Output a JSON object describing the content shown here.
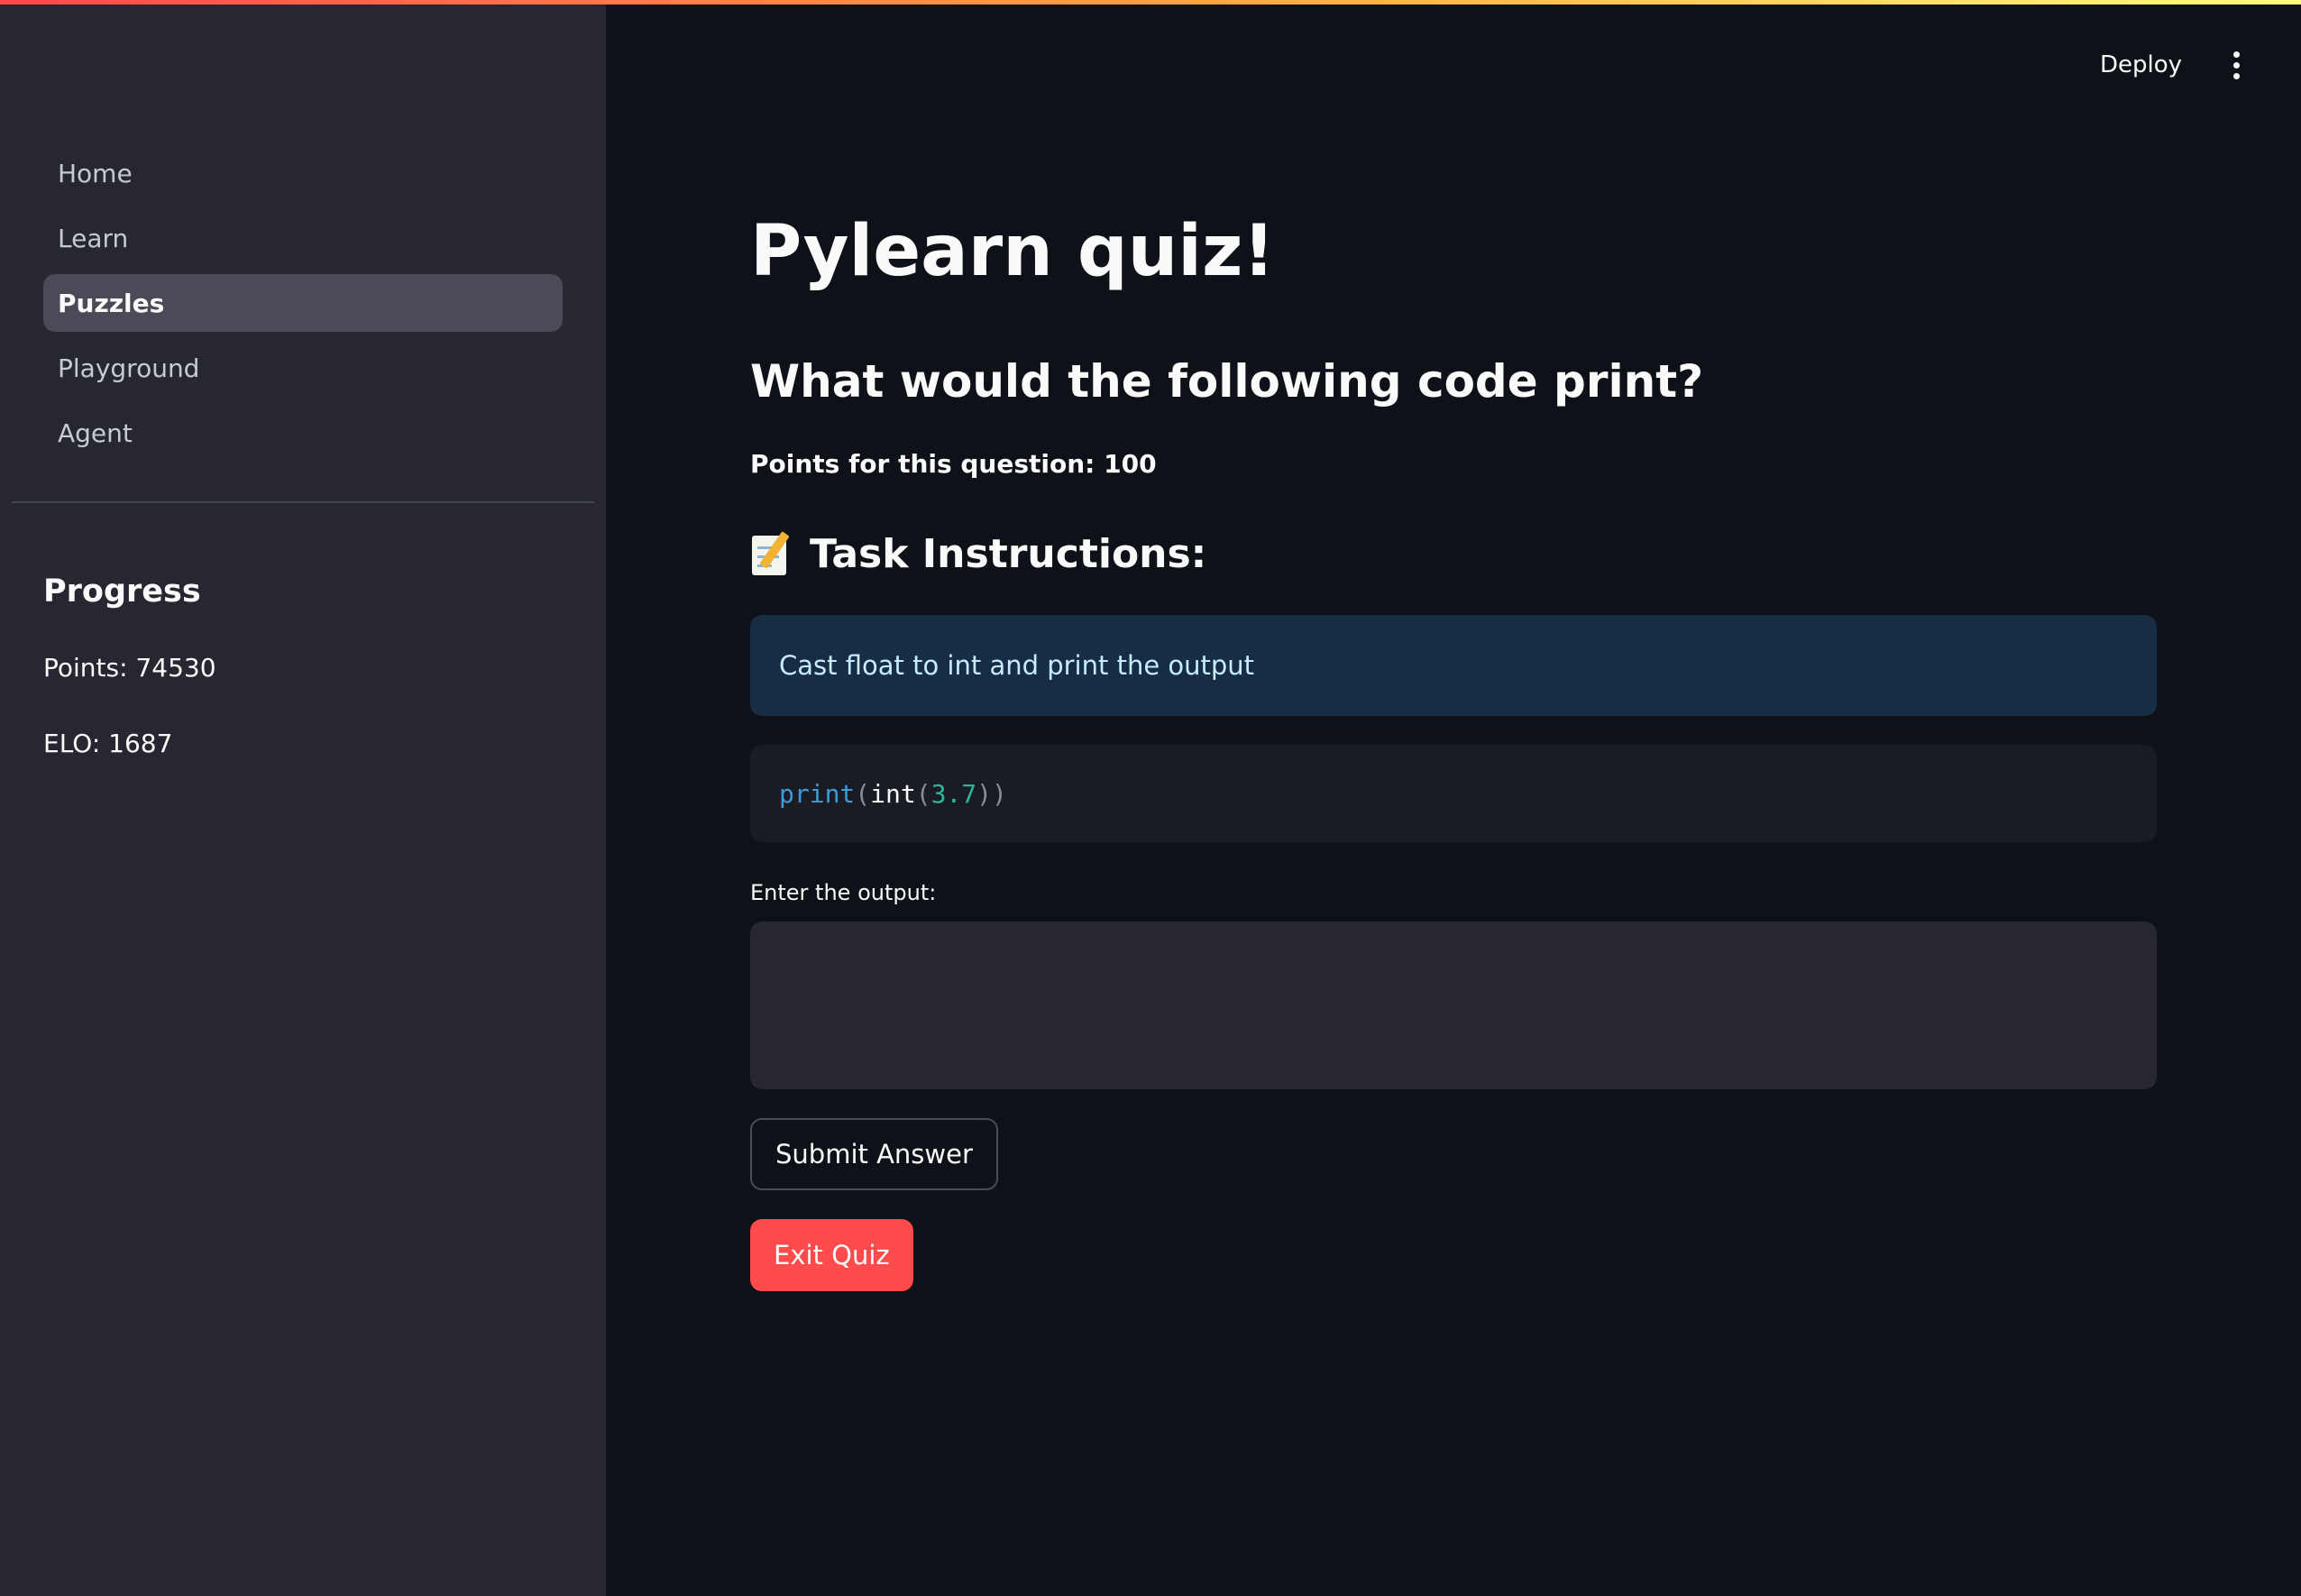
{
  "header": {
    "deploy_label": "Deploy",
    "menu_icon": "kebab-menu-icon"
  },
  "sidebar": {
    "items": [
      {
        "label": "Home",
        "active": false
      },
      {
        "label": "Learn",
        "active": false
      },
      {
        "label": "Puzzles",
        "active": true
      },
      {
        "label": "Playground",
        "active": false
      },
      {
        "label": "Agent",
        "active": false
      }
    ],
    "progress": {
      "heading": "Progress",
      "points": "Points: 74530",
      "elo": "ELO: 1687"
    }
  },
  "main": {
    "title": "Pylearn quiz!",
    "question": "What would the following code print?",
    "points_text": "Points for this question: 100",
    "instructions_heading": "Task Instructions:",
    "instructions_icon": "memo-icon",
    "instructions_text": "Cast float to int and print the output",
    "code": {
      "fn": "print",
      "open1": "(",
      "name": "int",
      "open2": "(",
      "num": "3.7",
      "close": "))"
    },
    "input_label": "Enter the output:",
    "input_value": "",
    "submit_label": "Submit Answer",
    "exit_label": "Exit Quiz"
  },
  "colors": {
    "background": "#0e1117",
    "sidebar": "#262730",
    "accent": "#ff4b4b",
    "info_bg": "#172d43",
    "info_text": "#c7ebff"
  }
}
